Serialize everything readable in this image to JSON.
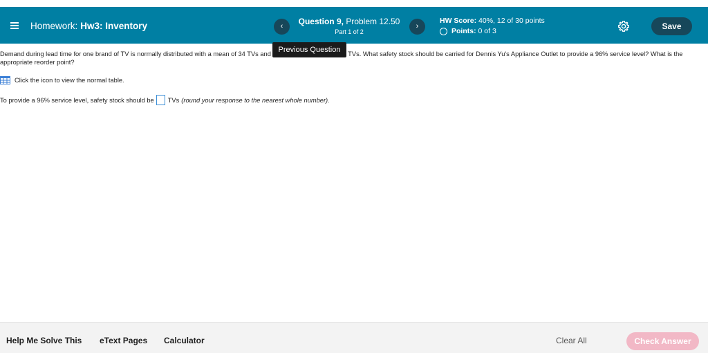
{
  "header": {
    "homework_prefix": "Homework:",
    "homework_name": "Hw3: Inventory",
    "question_label": "Question 9,",
    "problem_label": "Problem 12.50",
    "part_label": "Part 1 of 2",
    "prev_icon": "‹",
    "next_icon": "›",
    "score_label": "HW Score:",
    "score_value": "40%, 12 of 30 points",
    "points_label": "Points:",
    "points_value": "0 of 3",
    "save_label": "Save"
  },
  "tooltip": {
    "text": "Previous Question"
  },
  "question": {
    "problem_text": "Demand during lead time for one brand of TV is normally distributed with a mean of 34 TVs and a standard deviation of 11 TVs. What safety stock should be carried for Dennis Yu's Appliance Outlet to provide a 96% service level? What is the appropriate reorder point?",
    "table_hint": "Click the icon to view the normal table.",
    "answer_prefix": "To provide a 96% service level, safety stock should be",
    "answer_unit": "TVs",
    "answer_note": "(round your response to the nearest whole number)."
  },
  "footer": {
    "help_label": "Help Me Solve This",
    "etext_label": "eText Pages",
    "calculator_label": "Calculator",
    "clear_all_label": "Clear All",
    "check_answer_label": "Check Answer"
  },
  "colors": {
    "header_bg": "#007fa3",
    "button_dark": "#17475a",
    "check_answer_disabled": "#f2b8c6",
    "answer_box_border": "#3b8ed6"
  },
  "icons": [
    "menu-icon",
    "chevron-left-icon",
    "chevron-right-icon",
    "circle-icon",
    "gear-icon",
    "table-icon"
  ]
}
